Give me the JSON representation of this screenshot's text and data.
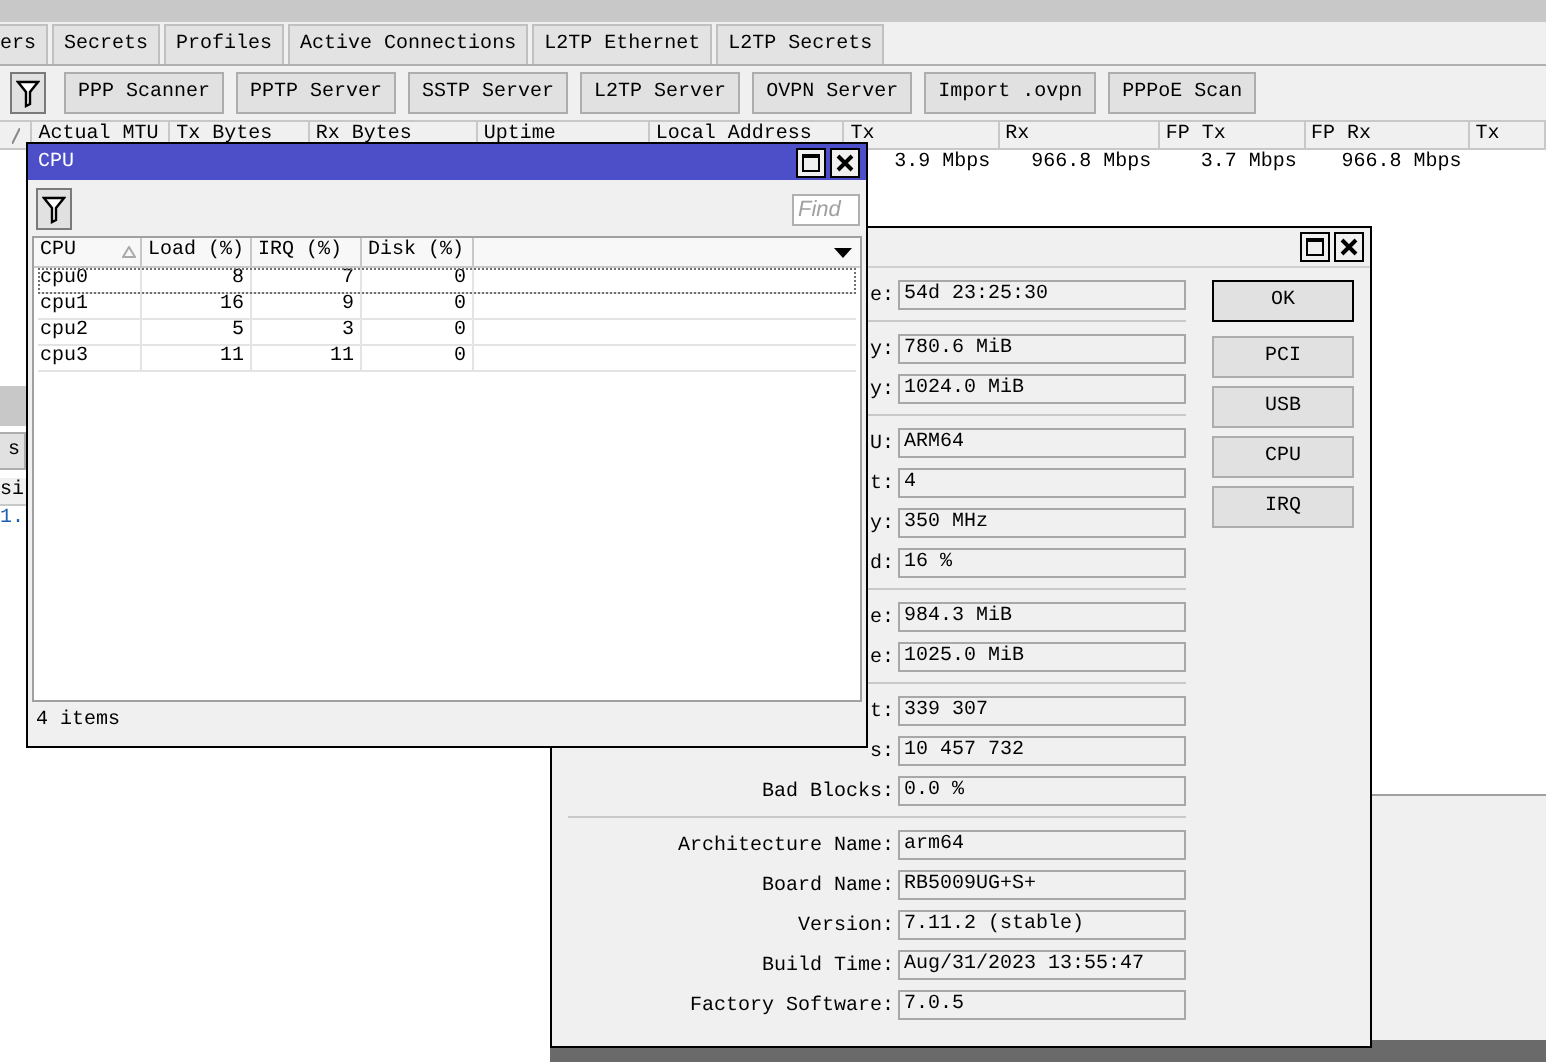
{
  "main": {
    "tabs": [
      {
        "label": "ers",
        "selected": false
      },
      {
        "label": "Secrets",
        "selected": false
      },
      {
        "label": "Profiles",
        "selected": false
      },
      {
        "label": "Active Connections",
        "selected": false
      },
      {
        "label": "L2TP Ethernet",
        "selected": false
      },
      {
        "label": "L2TP Secrets",
        "selected": false
      }
    ],
    "toolbar_buttons": [
      "PPP Scanner",
      "PPTP Server",
      "SSTP Server",
      "L2TP Server",
      "OVPN Server",
      "Import .ovpn",
      "PPPoE Scan"
    ],
    "table": {
      "columns": [
        "Actual MTU",
        "Tx Bytes",
        "Rx Bytes",
        "Uptime",
        "Local Address",
        "Tx",
        "Rx",
        "FP Tx",
        "FP Rx",
        "Tx"
      ],
      "rows": [
        {
          "tx": "3.9 Mbps",
          "rx": "966.8 Mbps",
          "fp_tx": "3.7 Mbps",
          "fp_rx": "966.8 Mbps"
        }
      ]
    }
  },
  "side_fragment": {
    "button": "s",
    "column": "si",
    "cell": "1."
  },
  "cpu_window": {
    "title": "CPU",
    "find_placeholder": "Find",
    "columns": [
      "CPU",
      "Load (%)",
      "IRQ (%)",
      "Disk (%)"
    ],
    "rows": [
      {
        "cpu": "cpu0",
        "load": "8",
        "irq": "7",
        "disk": "0",
        "focused": true
      },
      {
        "cpu": "cpu1",
        "load": "16",
        "irq": "9",
        "disk": "0",
        "focused": false
      },
      {
        "cpu": "cpu2",
        "load": "5",
        "irq": "3",
        "disk": "0",
        "focused": false
      },
      {
        "cpu": "cpu3",
        "load": "11",
        "irq": "11",
        "disk": "0",
        "focused": false
      }
    ],
    "status": "4 items"
  },
  "resource_window": {
    "groups": [
      [
        {
          "label": "e:",
          "value": "54d 23:25:30"
        }
      ],
      [
        {
          "label": "y:",
          "value": "780.6 MiB"
        },
        {
          "label": "y:",
          "value": "1024.0 MiB"
        }
      ],
      [
        {
          "label": "U:",
          "value": "ARM64"
        },
        {
          "label": "t:",
          "value": "4"
        },
        {
          "label": "y:",
          "value": "350 MHz"
        },
        {
          "label": "d:",
          "value": "16 %"
        }
      ],
      [
        {
          "label": "e:",
          "value": "984.3 MiB"
        },
        {
          "label": "e:",
          "value": "1025.0 MiB"
        }
      ],
      [
        {
          "label": "t:",
          "value": "339 307"
        },
        {
          "label": "s:",
          "value": "10 457 732"
        },
        {
          "label": "Bad Blocks:",
          "value": "0.0 %"
        }
      ],
      [
        {
          "label": "Architecture Name:",
          "value": "arm64"
        },
        {
          "label": "Board Name:",
          "value": "RB5009UG+S+"
        },
        {
          "label": "Version:",
          "value": "7.11.2 (stable)"
        },
        {
          "label": "Build Time:",
          "value": "Aug/31/2023 13:55:47"
        },
        {
          "label": "Factory Software:",
          "value": "7.0.5"
        }
      ]
    ],
    "buttons": [
      {
        "label": "OK",
        "default": true
      },
      {
        "label": "PCI",
        "default": false
      },
      {
        "label": "USB",
        "default": false
      },
      {
        "label": "CPU",
        "default": false
      },
      {
        "label": "IRQ",
        "default": false
      }
    ]
  }
}
